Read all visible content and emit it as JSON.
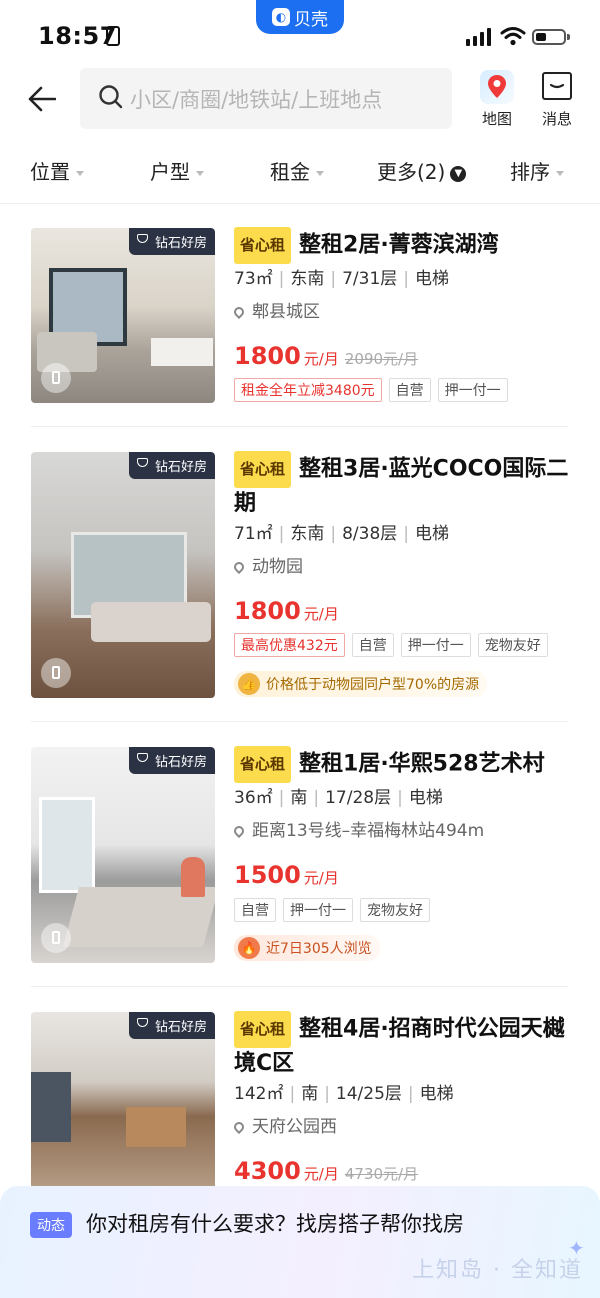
{
  "status_bar": {
    "time": "18:57",
    "app_badge": "贝壳"
  },
  "header": {
    "search_placeholder": "小区/商圈/地铁站/上班地点",
    "map_label": "地图",
    "message_label": "消息"
  },
  "filters": [
    {
      "label": "位置"
    },
    {
      "label": "户型"
    },
    {
      "label": "租金"
    },
    {
      "label": "更多(2)"
    },
    {
      "label": "排序"
    }
  ],
  "diamond_badge": "钻石好房",
  "save_tag": "省心租",
  "listings": [
    {
      "title": "整租2居·菁蓉滨湖湾",
      "area": "73㎡",
      "orientation": "东南",
      "floor": "7/31层",
      "elevator": "电梯",
      "location": "郫县城区",
      "price": "1800",
      "unit": "元/月",
      "old_price": "2090元/月",
      "tags": [
        "租金全年立减3480元",
        "自营",
        "押一付一"
      ],
      "hint": ""
    },
    {
      "title": "整租3居·蓝光COCO国际二期",
      "area": "71㎡",
      "orientation": "东南",
      "floor": "8/38层",
      "elevator": "电梯",
      "location": "动物园",
      "price": "1800",
      "unit": "元/月",
      "old_price": "",
      "tags": [
        "最高优惠432元",
        "自营",
        "押一付一",
        "宠物友好"
      ],
      "hint": "价格低于动物园同户型70%的房源"
    },
    {
      "title": "整租1居·华熙528艺术村",
      "area": "36㎡",
      "orientation": "南",
      "floor": "17/28层",
      "elevator": "电梯",
      "location": "距离13号线–幸福梅林站494m",
      "price": "1500",
      "unit": "元/月",
      "old_price": "",
      "tags": [
        "自营",
        "押一付一",
        "宠物友好"
      ],
      "hint": "近7日305人浏览"
    },
    {
      "title": "整租4居·招商时代公园天樾境C区",
      "area": "142㎡",
      "orientation": "南",
      "floor": "14/25层",
      "elevator": "电梯",
      "location": "天府公园西",
      "price": "4300",
      "unit": "元/月",
      "old_price": "4730元/月",
      "tags": [],
      "hint": ""
    }
  ],
  "banner": {
    "tag": "动态",
    "text": "你对租房有什么要求？找房搭子帮你找房",
    "slogan": "上知岛 · 全知道"
  }
}
